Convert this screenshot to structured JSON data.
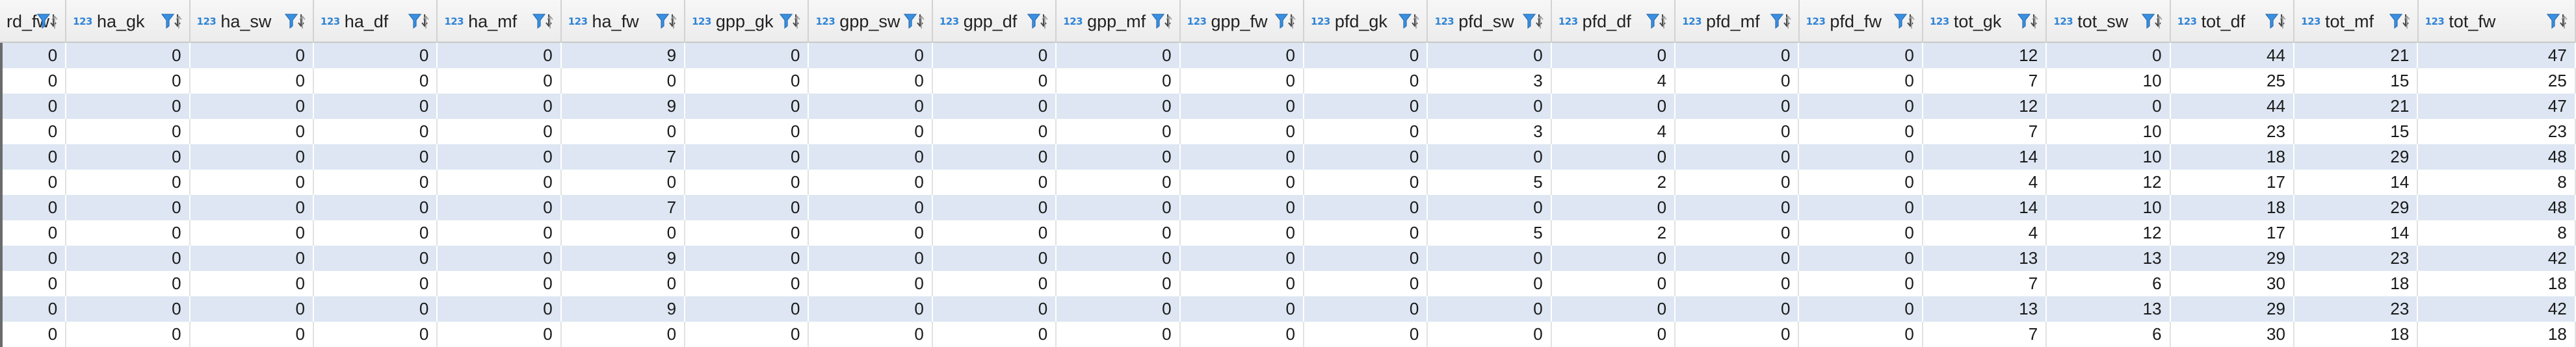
{
  "columns": [
    {
      "name": "rd_fw",
      "badge": ""
    },
    {
      "name": "ha_gk",
      "badge": "123"
    },
    {
      "name": "ha_sw",
      "badge": "123"
    },
    {
      "name": "ha_df",
      "badge": "123"
    },
    {
      "name": "ha_mf",
      "badge": "123"
    },
    {
      "name": "ha_fw",
      "badge": "123"
    },
    {
      "name": "gpp_gk",
      "badge": "123"
    },
    {
      "name": "gpp_sw",
      "badge": "123"
    },
    {
      "name": "gpp_df",
      "badge": "123"
    },
    {
      "name": "gpp_mf",
      "badge": "123"
    },
    {
      "name": "gpp_fw",
      "badge": "123"
    },
    {
      "name": "pfd_gk",
      "badge": "123"
    },
    {
      "name": "pfd_sw",
      "badge": "123"
    },
    {
      "name": "pfd_df",
      "badge": "123"
    },
    {
      "name": "pfd_mf",
      "badge": "123"
    },
    {
      "name": "pfd_fw",
      "badge": "123"
    },
    {
      "name": "tot_gk",
      "badge": "123"
    },
    {
      "name": "tot_sw",
      "badge": "123"
    },
    {
      "name": "tot_df",
      "badge": "123"
    },
    {
      "name": "tot_mf",
      "badge": "123"
    },
    {
      "name": "tot_fw",
      "badge": "123"
    }
  ],
  "rows": [
    [
      "0",
      "0",
      "0",
      "0",
      "0",
      "9",
      "0",
      "0",
      "0",
      "0",
      "0",
      "0",
      "0",
      "0",
      "0",
      "0",
      "12",
      "0",
      "44",
      "21",
      "47"
    ],
    [
      "0",
      "0",
      "0",
      "0",
      "0",
      "0",
      "0",
      "0",
      "0",
      "0",
      "0",
      "0",
      "3",
      "4",
      "0",
      "0",
      "7",
      "10",
      "25",
      "15",
      "25"
    ],
    [
      "0",
      "0",
      "0",
      "0",
      "0",
      "9",
      "0",
      "0",
      "0",
      "0",
      "0",
      "0",
      "0",
      "0",
      "0",
      "0",
      "12",
      "0",
      "44",
      "21",
      "47"
    ],
    [
      "0",
      "0",
      "0",
      "0",
      "0",
      "0",
      "0",
      "0",
      "0",
      "0",
      "0",
      "0",
      "3",
      "4",
      "0",
      "0",
      "7",
      "10",
      "23",
      "15",
      "23"
    ],
    [
      "0",
      "0",
      "0",
      "0",
      "0",
      "7",
      "0",
      "0",
      "0",
      "0",
      "0",
      "0",
      "0",
      "0",
      "0",
      "0",
      "14",
      "10",
      "18",
      "29",
      "48"
    ],
    [
      "0",
      "0",
      "0",
      "0",
      "0",
      "0",
      "0",
      "0",
      "0",
      "0",
      "0",
      "0",
      "5",
      "2",
      "0",
      "0",
      "4",
      "12",
      "17",
      "14",
      "8"
    ],
    [
      "0",
      "0",
      "0",
      "0",
      "0",
      "7",
      "0",
      "0",
      "0",
      "0",
      "0",
      "0",
      "0",
      "0",
      "0",
      "0",
      "14",
      "10",
      "18",
      "29",
      "48"
    ],
    [
      "0",
      "0",
      "0",
      "0",
      "0",
      "0",
      "0",
      "0",
      "0",
      "0",
      "0",
      "0",
      "5",
      "2",
      "0",
      "0",
      "4",
      "12",
      "17",
      "14",
      "8"
    ],
    [
      "0",
      "0",
      "0",
      "0",
      "0",
      "9",
      "0",
      "0",
      "0",
      "0",
      "0",
      "0",
      "0",
      "0",
      "0",
      "0",
      "13",
      "13",
      "29",
      "23",
      "42"
    ],
    [
      "0",
      "0",
      "0",
      "0",
      "0",
      "0",
      "0",
      "0",
      "0",
      "0",
      "0",
      "0",
      "0",
      "0",
      "0",
      "0",
      "7",
      "6",
      "30",
      "18",
      "18"
    ],
    [
      "0",
      "0",
      "0",
      "0",
      "0",
      "9",
      "0",
      "0",
      "0",
      "0",
      "0",
      "0",
      "0",
      "0",
      "0",
      "0",
      "13",
      "13",
      "29",
      "23",
      "42"
    ],
    [
      "0",
      "0",
      "0",
      "0",
      "0",
      "0",
      "0",
      "0",
      "0",
      "0",
      "0",
      "0",
      "0",
      "0",
      "0",
      "0",
      "7",
      "6",
      "30",
      "18",
      "18"
    ]
  ],
  "icons": {
    "header_filter": "filter-sort-icon"
  },
  "colors": {
    "accent": "#2f84d6",
    "alt_row": "#dde6f2",
    "header_bg": "#efefef"
  }
}
